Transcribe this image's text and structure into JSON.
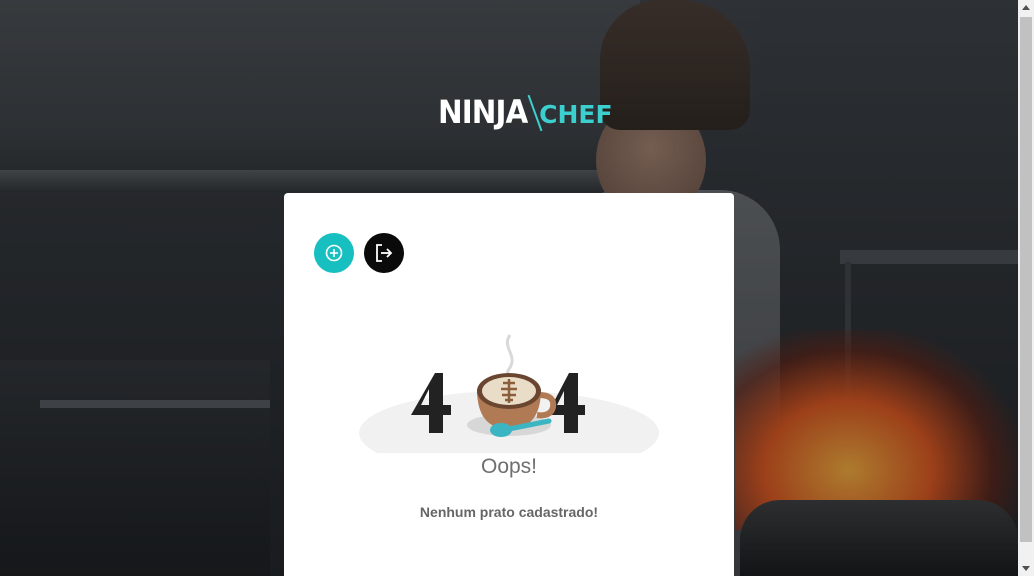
{
  "brand": {
    "name_primary": "NINJA",
    "name_accent": "CHEF",
    "accent_color": "#3ccfcf"
  },
  "toolbar": {
    "add_icon": "plus-circle-icon",
    "add_color": "#17bfc1",
    "logout_icon": "logout-icon",
    "logout_color": "#0a0a0a"
  },
  "empty_state": {
    "illustration": "404-coffee-cup",
    "title": "Oops!",
    "message": "Nenhum prato cadastrado!"
  }
}
